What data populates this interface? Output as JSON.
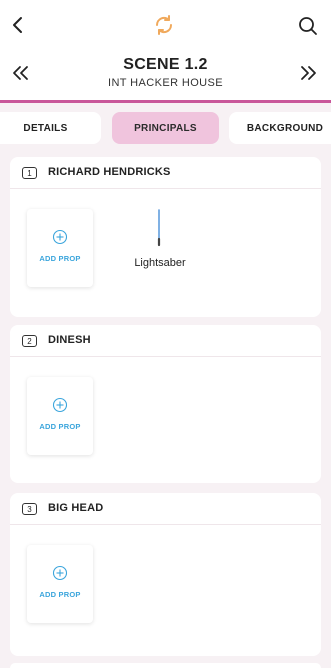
{
  "colors": {
    "accent": "#c9579a",
    "active_tab": "#f0c4dd",
    "add_prop_text": "#3ba5dc",
    "sync_icon": "#f0a95c",
    "page_bg": "#f7f1f4"
  },
  "topbar": {
    "back_icon": "chevron-left-icon",
    "sync_icon": "sync-icon",
    "search_icon": "search-icon"
  },
  "scene": {
    "title": "SCENE 1.2",
    "subtitle": "INT HACKER HOUSE",
    "prev_icon": "double-chevron-left-icon",
    "next_icon": "double-chevron-right-icon"
  },
  "tabs": [
    {
      "label": "DETAILS",
      "active": false
    },
    {
      "label": "PRINCIPALS",
      "active": true
    },
    {
      "label": "BACKGROUND",
      "active": false
    }
  ],
  "principals": [
    {
      "number": "1",
      "name": "RICHARD HENDRICKS",
      "add_label": "ADD PROP",
      "props": [
        "Lightsaber"
      ]
    },
    {
      "number": "2",
      "name": "DINESH",
      "add_label": "ADD PROP",
      "props": []
    },
    {
      "number": "3",
      "name": "BIG HEAD",
      "add_label": "ADD PROP",
      "props": []
    }
  ]
}
